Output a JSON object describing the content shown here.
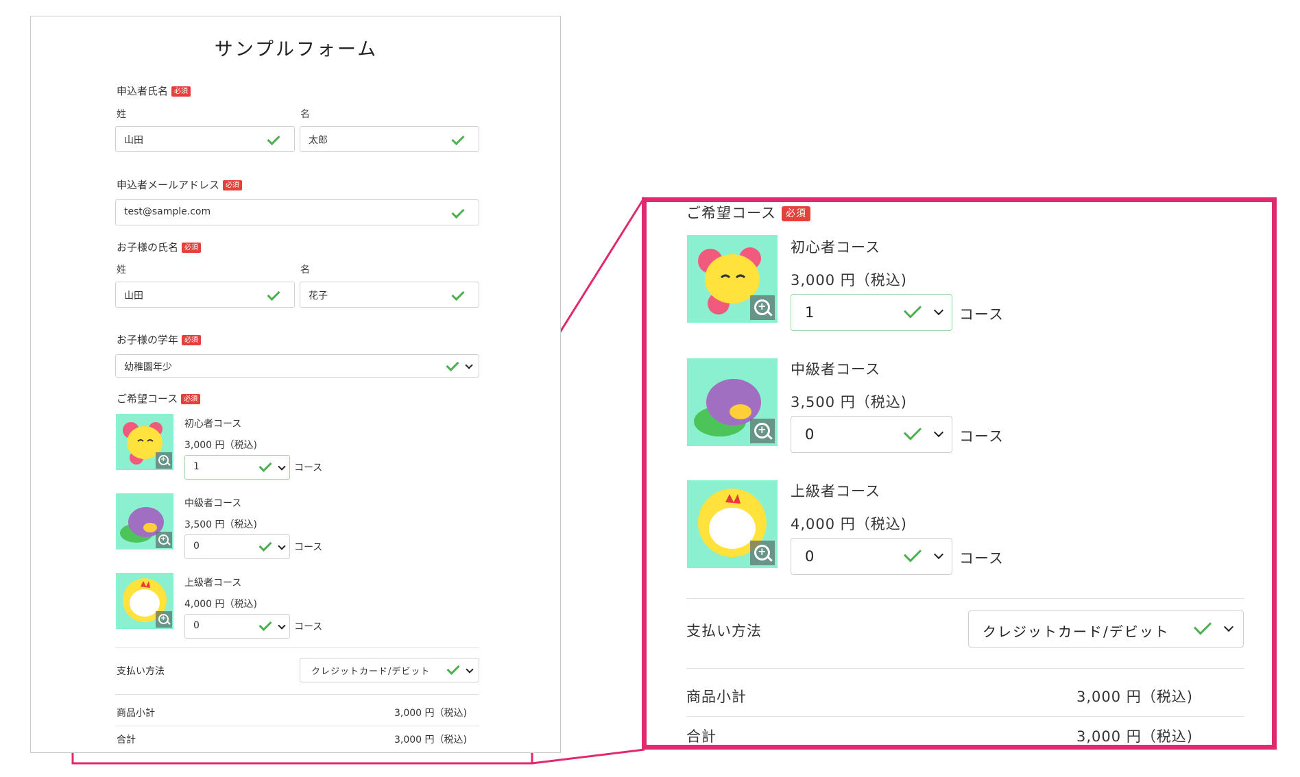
{
  "form": {
    "title": "サンプルフォーム",
    "required_badge": "必須",
    "applicant_name": {
      "label": "申込者氏名",
      "last_label": "姓",
      "first_label": "名",
      "last_value": "山田",
      "first_value": "太郎"
    },
    "applicant_email": {
      "label": "申込者メールアドレス",
      "value": "test@sample.com"
    },
    "child_name": {
      "label": "お子様の氏名",
      "last_label": "姓",
      "first_label": "名",
      "last_value": "山田",
      "first_value": "花子"
    },
    "child_grade": {
      "label": "お子様の学年",
      "value": "幼稚園年少"
    },
    "course": {
      "label": "ご希望コース",
      "unit": "コース",
      "items": [
        {
          "name": "初心者コース",
          "price": "3,000 円（税込)",
          "qty": "1",
          "image": "yellow-bird-illustration"
        },
        {
          "name": "中級者コース",
          "price": "3,500 円（税込)",
          "qty": "0",
          "image": "purple-bird-illustration"
        },
        {
          "name": "上級者コース",
          "price": "4,000 円（税込)",
          "qty": "0",
          "image": "white-chicken-illustration"
        }
      ]
    },
    "payment": {
      "label": "支払い方法",
      "value": "クレジットカード/デビット"
    },
    "subtotal": {
      "label": "商品小計",
      "value": "3,000 円（税込)"
    },
    "total": {
      "label": "合計",
      "value": "3,000 円（税込)"
    }
  },
  "colors": {
    "highlight": "#e0296f",
    "check": "#4caf50",
    "required": "#e5413c",
    "image_bg": "#8bf0cf"
  },
  "icons": [
    "check-icon",
    "chevron-down-icon",
    "zoom-in-icon"
  ]
}
